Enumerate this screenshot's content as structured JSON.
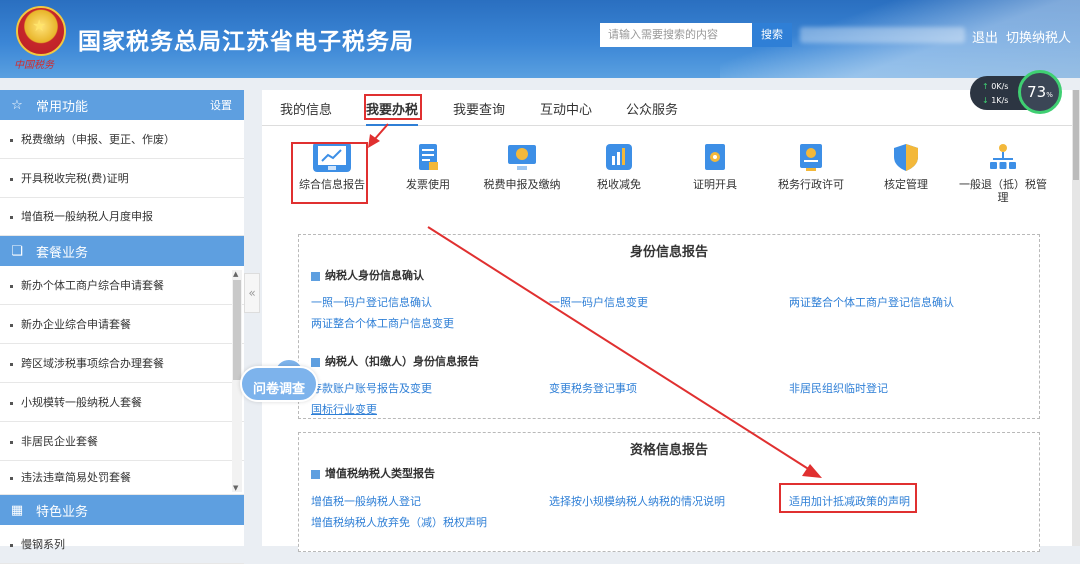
{
  "header": {
    "site_title": "国家税务总局江苏省电子税务局",
    "emblem_subtitle": "中国税务",
    "search_placeholder": "请输入需要搜索的内容",
    "search_button": "搜索",
    "logout": "退出",
    "switch_taxpayer": "切换纳税人"
  },
  "sidebar": {
    "common": {
      "title": "常用功能",
      "settings": "设置",
      "items": [
        "税费缴纳（申报、更正、作废）",
        "开具税收完税(费)证明",
        "增值税一般纳税人月度申报"
      ]
    },
    "package": {
      "title": "套餐业务",
      "items": [
        "新办个体工商户综合申请套餐",
        "新办企业综合申请套餐",
        "跨区域涉税事项综合办理套餐",
        "小规模转一般纳税人套餐",
        "非居民企业套餐",
        "违法违章简易处罚套餐"
      ]
    },
    "special": {
      "title": "特色业务",
      "items": [
        "慢钢系列"
      ]
    }
  },
  "survey": "问卷调查",
  "tabs": [
    "我的信息",
    "我要办税",
    "我要查询",
    "互动中心",
    "公众服务"
  ],
  "active_tab": "我要办税",
  "categories": [
    {
      "label": "综合信息报告",
      "icon": "monitor-chart-icon"
    },
    {
      "label": "发票使用",
      "icon": "invoice-icon"
    },
    {
      "label": "税费申报及缴纳",
      "icon": "tax-declare-icon"
    },
    {
      "label": "税收减免",
      "icon": "tax-reduction-icon"
    },
    {
      "label": "证明开具",
      "icon": "certificate-icon"
    },
    {
      "label": "税务行政许可",
      "icon": "license-icon"
    },
    {
      "label": "核定管理",
      "icon": "shield-icon"
    },
    {
      "label": "一般退（抵）税管理",
      "icon": "tree-icon"
    }
  ],
  "identity_section": {
    "title": "身份信息报告",
    "group1": {
      "title": "纳税人身份信息确认",
      "links": [
        "一照一码户登记信息确认",
        "一照一码户信息变更",
        "两证整合个体工商户登记信息确认",
        "两证整合个体工商户信息变更"
      ]
    },
    "group2": {
      "title": "纳税人（扣缴人）身份信息报告",
      "links": [
        "存款账户账号报告及变更",
        "变更税务登记事项",
        "非居民组织临时登记",
        "国标行业变更"
      ]
    }
  },
  "qualification_section": {
    "title": "资格信息报告",
    "group1": {
      "title": "增值税纳税人类型报告",
      "links": [
        "增值税一般纳税人登记",
        "选择按小规模纳税人纳税的情况说明",
        "适用加计抵减政策的声明",
        "增值税纳税人放弃免（减）税权声明"
      ]
    }
  },
  "speed_widget": {
    "up": "0K/s",
    "down": "1K/s",
    "percent": "73",
    "unit": "%"
  },
  "colors": {
    "header_blue": "#3b86d6",
    "sidebar_head": "#5e9fe0",
    "link": "#2f7fd6",
    "highlight": "#e03030"
  }
}
